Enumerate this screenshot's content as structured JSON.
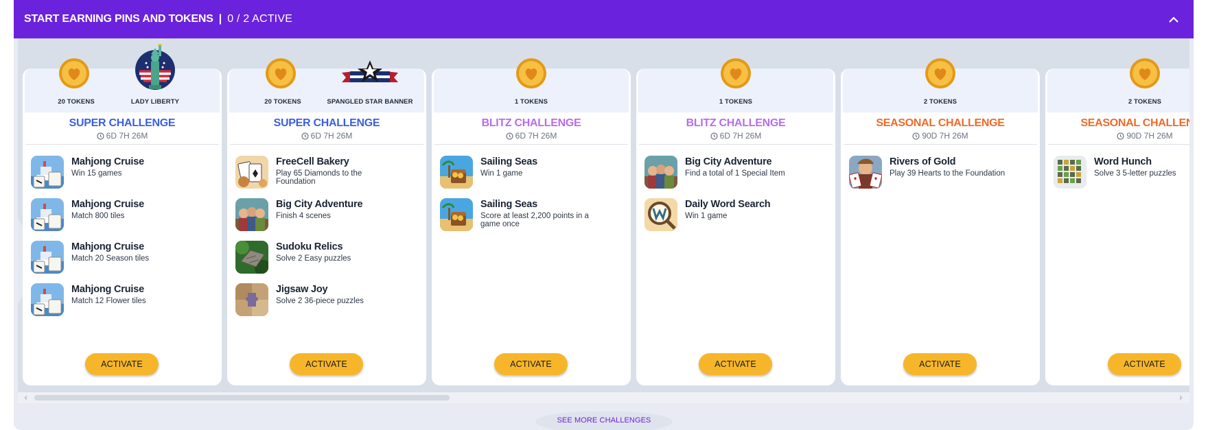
{
  "header": {
    "title": "START EARNING PINS AND TOKENS",
    "separator": "|",
    "active_count": "0 / 2 ACTIVE"
  },
  "colors": {
    "header_bg": "#6a22dc",
    "super": "#3b5fe0",
    "blitz": "#b86cf0",
    "seasonal": "#f06a28",
    "activate": "#f7b62a"
  },
  "cards": [
    {
      "tokens_label": "20 TOKENS",
      "pin_label": "LADY LIBERTY",
      "title": "SUPER CHALLENGE",
      "timer": "6D 7H 26M",
      "tasks": [
        {
          "game": "Mahjong Cruise",
          "desc": "Win 15 games"
        },
        {
          "game": "Mahjong Cruise",
          "desc": "Match 800 tiles"
        },
        {
          "game": "Mahjong Cruise",
          "desc": "Match 20 Season tiles"
        },
        {
          "game": "Mahjong Cruise",
          "desc": "Match 12 Flower tiles"
        }
      ],
      "button": "ACTIVATE"
    },
    {
      "tokens_label": "20 TOKENS",
      "pin_label": "SPANGLED STAR BANNER",
      "title": "SUPER CHALLENGE",
      "timer": "6D 7H 26M",
      "tasks": [
        {
          "game": "FreeCell Bakery",
          "desc": "Play 65 Diamonds to the Foundation"
        },
        {
          "game": "Big City Adventure",
          "desc": "Finish 4 scenes"
        },
        {
          "game": "Sudoku Relics",
          "desc": "Solve 2 Easy puzzles"
        },
        {
          "game": "Jigsaw Joy",
          "desc": "Solve 2 36-piece puzzles"
        }
      ],
      "button": "ACTIVATE"
    },
    {
      "tokens_label": "1 TOKENS",
      "title": "BLITZ CHALLENGE",
      "timer": "6D 7H 26M",
      "tasks": [
        {
          "game": "Sailing Seas",
          "desc": "Win 1 game"
        },
        {
          "game": "Sailing Seas",
          "desc": "Score at least 2,200 points in a game once"
        }
      ],
      "button": "ACTIVATE"
    },
    {
      "tokens_label": "1 TOKENS",
      "title": "BLITZ CHALLENGE",
      "timer": "6D 7H 26M",
      "tasks": [
        {
          "game": "Big City Adventure",
          "desc": "Find a total of 1 Special Item"
        },
        {
          "game": "Daily Word Search",
          "desc": "Win 1 game"
        }
      ],
      "button": "ACTIVATE"
    },
    {
      "tokens_label": "2 TOKENS",
      "title": "SEASONAL CHALLENGE",
      "timer": "90D 7H 26M",
      "tasks": [
        {
          "game": "Rivers of Gold",
          "desc": "Play 39 Hearts to the Foundation"
        }
      ],
      "button": "ACTIVATE"
    },
    {
      "tokens_label": "2 TOKENS",
      "title": "SEASONAL CHALLENGE",
      "timer": "90D 7H 26M",
      "tasks": [
        {
          "game": "Word Hunch",
          "desc": "Solve 3 5-letter puzzles"
        }
      ],
      "button": "ACTIVATE"
    }
  ],
  "footer": {
    "see_more": "SEE MORE CHALLENGES"
  }
}
